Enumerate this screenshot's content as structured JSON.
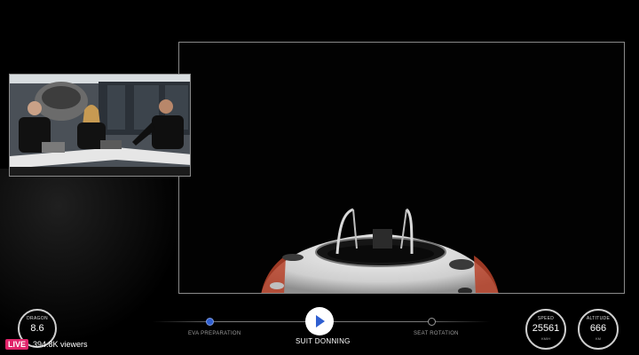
{
  "gauges": {
    "dragon": {
      "label": "DRAGON",
      "value": "8.6"
    },
    "speed": {
      "label": "SPEED",
      "value": "25561",
      "unit": "KM/H"
    },
    "altitude": {
      "label": "ALTITUDE",
      "value": "666",
      "unit": "KM"
    }
  },
  "timeline": {
    "stages": [
      {
        "label": "EVA PREPARATION"
      },
      {
        "label": "SUIT DONNING"
      },
      {
        "label": "SEAT ROTATION"
      }
    ]
  },
  "stream": {
    "live": "LIVE",
    "viewers": "394.8K viewers"
  },
  "colors": {
    "accent_blue": "#2f5fd0",
    "live_pink": "#e0246a",
    "capsule_red": "#b8432a"
  },
  "icons": {
    "active_stage": "play-chevron-icon"
  }
}
